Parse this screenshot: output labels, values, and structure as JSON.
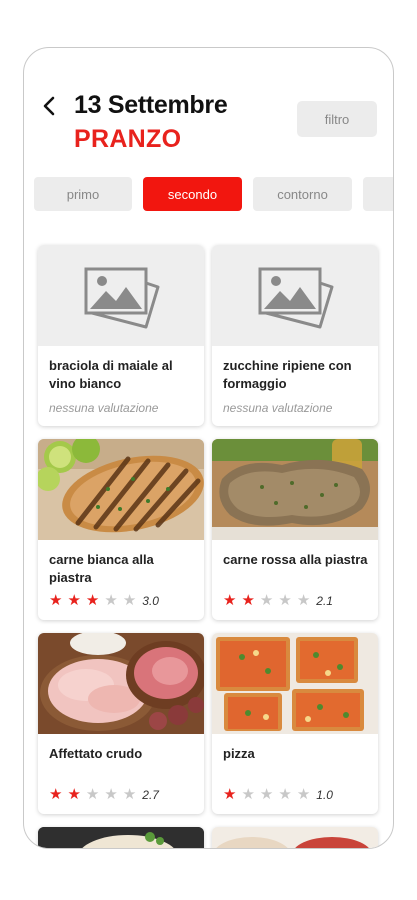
{
  "header": {
    "date_title": "13 Settembre",
    "meal_title": "PRANZO",
    "filter_label": "filtro"
  },
  "tabs": [
    {
      "label": "primo",
      "active": false
    },
    {
      "label": "secondo",
      "active": true
    },
    {
      "label": "contorno",
      "active": false
    },
    {
      "label": "",
      "active": false
    }
  ],
  "dishes": [
    {
      "name": "braciola di maiale al vino bianco",
      "image": "placeholder-image-icon",
      "rating_text": "nessuna valutazione",
      "rating": null
    },
    {
      "name": "zucchine ripiene con formaggio",
      "image": "placeholder-image-icon",
      "rating_text": "nessuna valutazione",
      "rating": null
    },
    {
      "name": "carne bianca alla piastra",
      "image": "grilled-chicken-photo",
      "rating": 3,
      "rating_value": "3.0"
    },
    {
      "name": "carne rossa alla piastra",
      "image": "grilled-steak-photo",
      "rating": 2,
      "rating_value": "2.1"
    },
    {
      "name": "Affettato crudo",
      "image": "cold-cuts-photo",
      "rating": 2,
      "rating_value": "2.7"
    },
    {
      "name": "pizza",
      "image": "pizza-photo",
      "rating": 1,
      "rating_value": "1.0"
    }
  ],
  "colors": {
    "accent": "#e8221d",
    "tab_active": "#f2160f",
    "tab_inactive": "#ececec",
    "star_off": "#c8c8c8"
  }
}
